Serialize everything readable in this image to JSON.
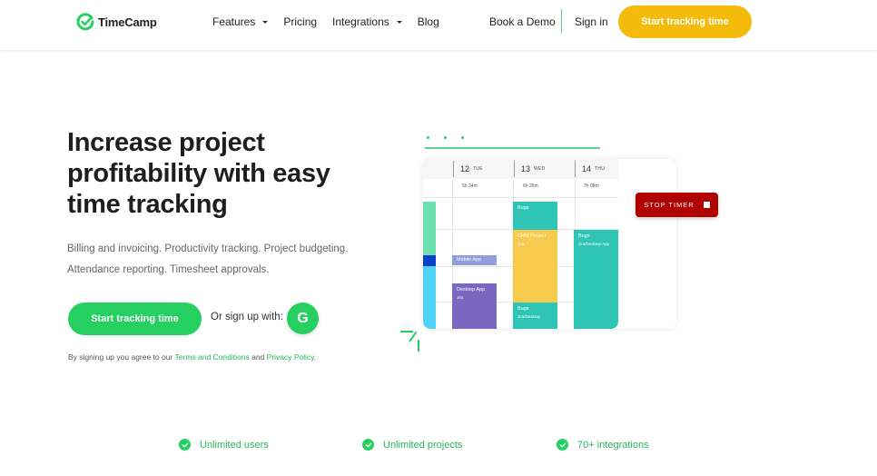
{
  "header": {
    "brand": "TimeCamp",
    "nav": [
      {
        "label": "Features",
        "has_dropdown": true
      },
      {
        "label": "Pricing",
        "has_dropdown": false
      },
      {
        "label": "Integrations",
        "has_dropdown": true
      },
      {
        "label": "Blog",
        "has_dropdown": false
      }
    ],
    "book_demo": "Book a Demo",
    "sign_in": "Sign in",
    "cta": "Start tracking time"
  },
  "hero": {
    "title": "Increase project profitability with easy time tracking",
    "subtitle": "Billing and invoicing. Productivity tracking. Project budgeting. Attendance reporting. Timesheet approvals.",
    "cta": "Start tracking time",
    "or_sign_up": "Or sign up with:",
    "google_icon": "G",
    "terms_prefix": "By signing up you agree to our ",
    "terms_link": "Terms and Conditions",
    "terms_and": " and ",
    "privacy_link": "Privacy Policy",
    "terms_suffix": "."
  },
  "illustration": {
    "days": [
      {
        "num": "12",
        "name": "TUE",
        "total": "5h 24m"
      },
      {
        "num": "13",
        "name": "WED",
        "total": "6h 26m"
      },
      {
        "num": "14",
        "name": "THU",
        "total": "7h 08m"
      }
    ],
    "blocks": [
      {
        "title": "Mobile App",
        "sub": "",
        "color": "#8e9fdc"
      },
      {
        "title": "Desktop App",
        "sub": "Jira",
        "color": "#7a68c0"
      },
      {
        "title": "Bugs",
        "sub": "",
        "color": "#2ec4b6"
      },
      {
        "title": "CRM Project",
        "sub": "Jira",
        "color": "#f7cb4d"
      },
      {
        "title": "Bugs",
        "sub": "Jira/Desktop",
        "color": "#2ec4b6"
      },
      {
        "title": "Bugs",
        "sub": "Jira/Desktop App",
        "color": "#2ec4b6"
      }
    ],
    "stop_timer": "STOP TIMER"
  },
  "features": [
    {
      "label": "Unlimited users"
    },
    {
      "label": "Unlimited projects"
    },
    {
      "label": "70+ integrations"
    }
  ],
  "colors": {
    "brand_green": "#25cf60",
    "cta_yellow": "#f4bb0a",
    "stop_red": "#b00000"
  }
}
